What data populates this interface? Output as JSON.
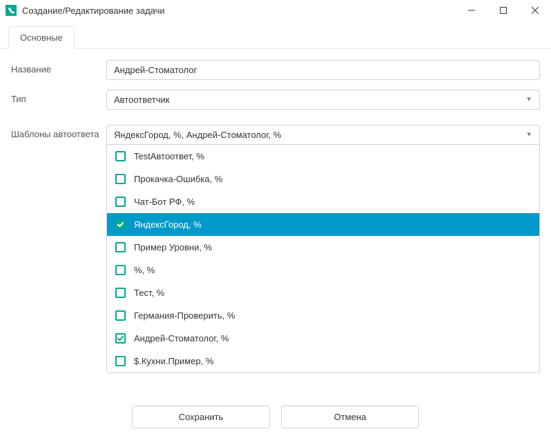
{
  "window": {
    "title": "Создание/Редактирование задачи"
  },
  "tabs": {
    "main": "Основные"
  },
  "form": {
    "name_label": "Название",
    "name_value": "Андрей-Стоматолог",
    "type_label": "Тип",
    "type_value": "Автоответчик",
    "templates_label": "Шаблоны автоответа",
    "templates_value": "ЯндексГород, %, Андрей-Стоматолог, %"
  },
  "template_options": [
    {
      "label": "TestАвтоответ, %",
      "checked": false,
      "highlighted": false
    },
    {
      "label": "Прокачка-Ошибка, %",
      "checked": false,
      "highlighted": false
    },
    {
      "label": "Чат-Бот РФ, %",
      "checked": false,
      "highlighted": false
    },
    {
      "label": "ЯндексГород, %",
      "checked": true,
      "highlighted": true
    },
    {
      "label": "Пример Уровни, %",
      "checked": false,
      "highlighted": false
    },
    {
      "label": "%, %",
      "checked": false,
      "highlighted": false
    },
    {
      "label": "Тест, %",
      "checked": false,
      "highlighted": false
    },
    {
      "label": "Германия-Проверить, %",
      "checked": false,
      "highlighted": false
    },
    {
      "label": "Андрей-Стоматолог, %",
      "checked": true,
      "highlighted": false
    },
    {
      "label": "$.Кухни.Пример, %",
      "checked": false,
      "highlighted": false
    }
  ],
  "footer": {
    "save": "Сохранить",
    "cancel": "Отмена"
  }
}
